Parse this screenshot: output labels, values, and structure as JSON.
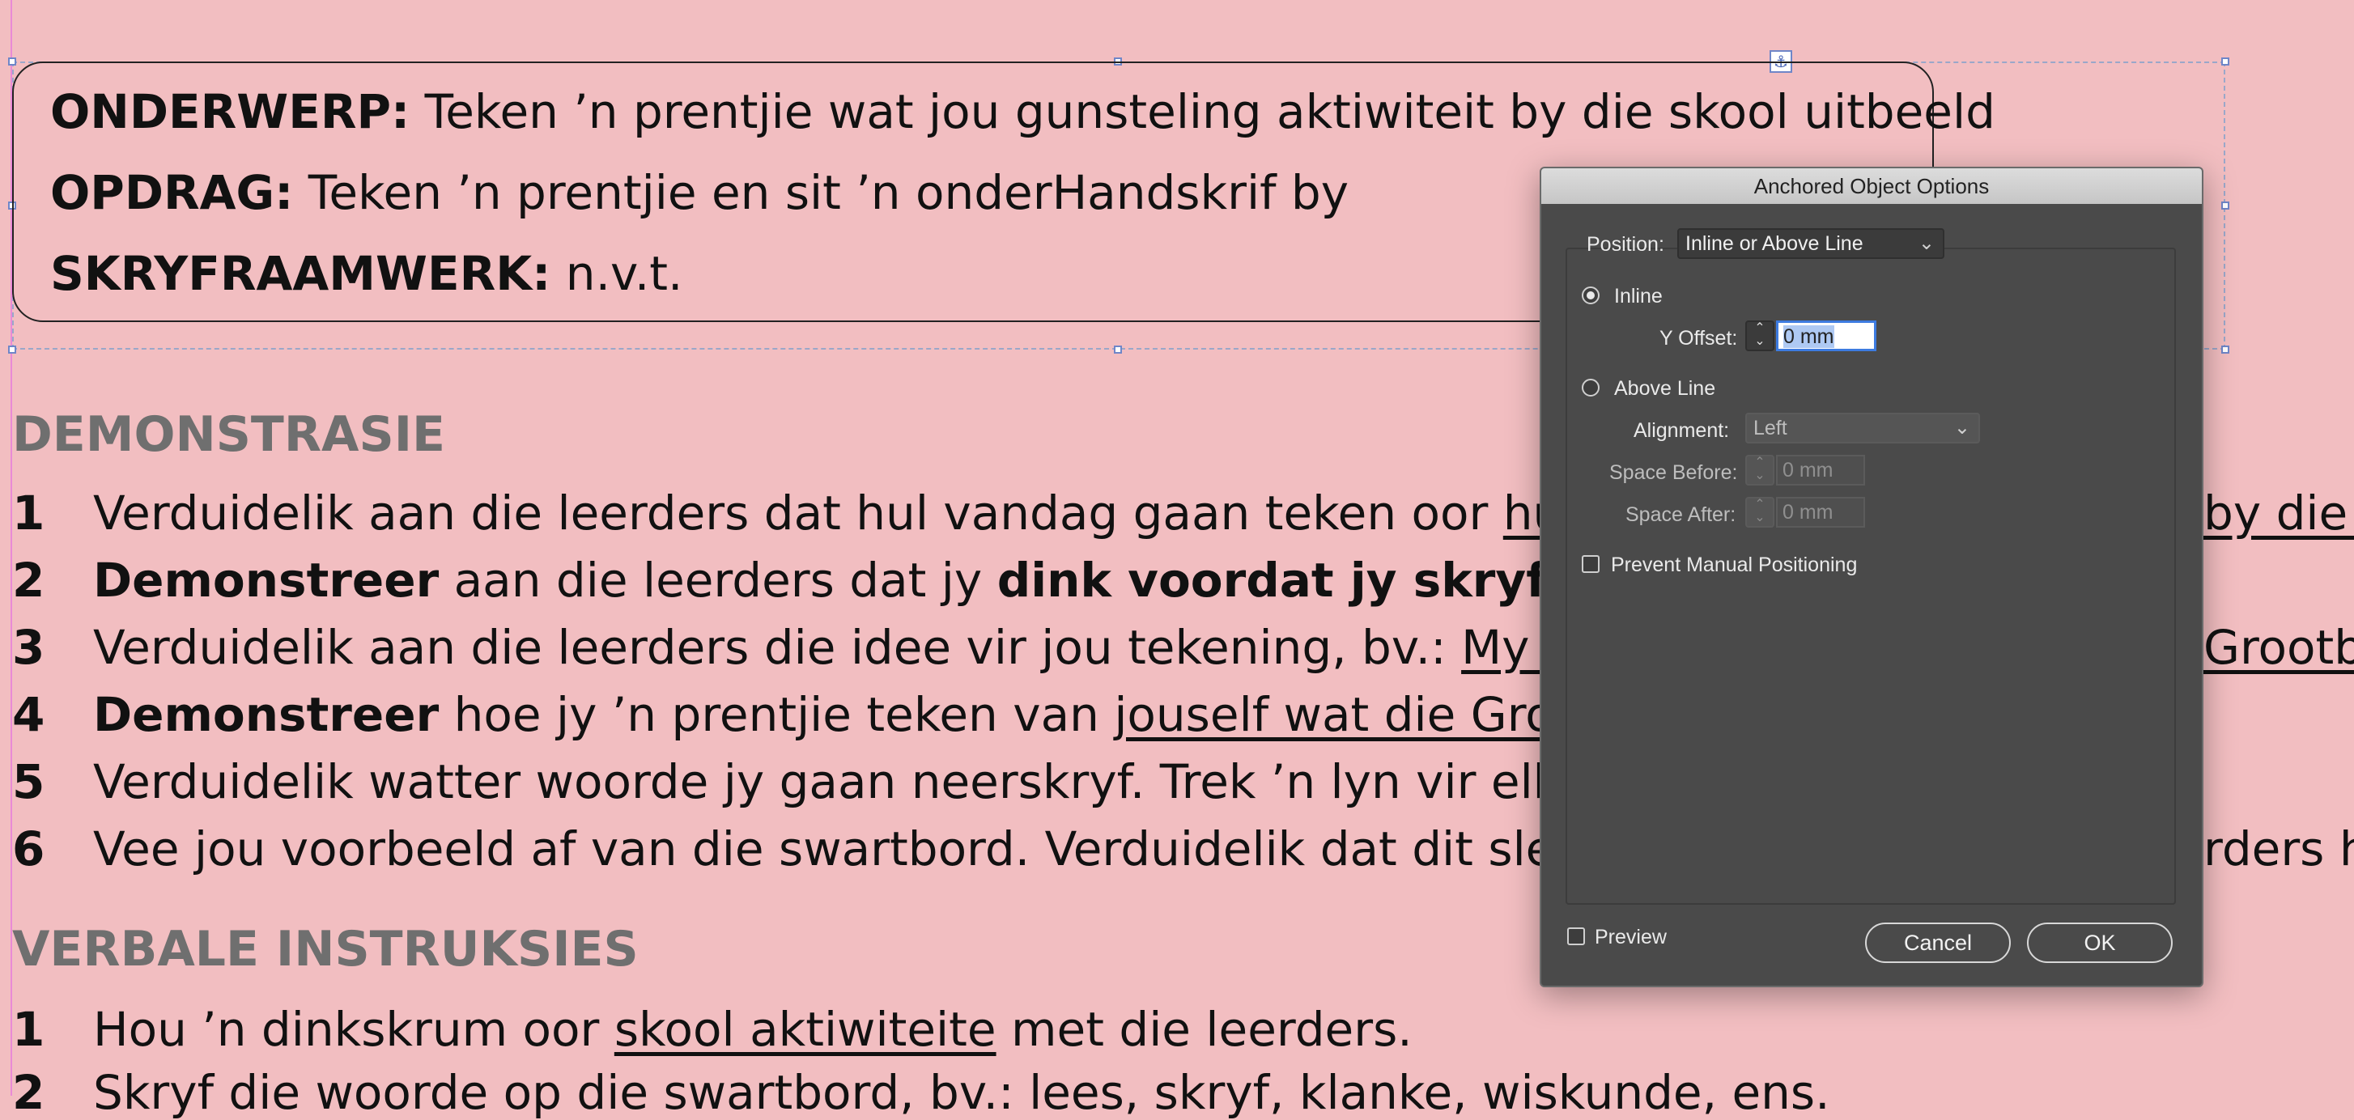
{
  "document": {
    "top_box": [
      {
        "label": "ONDERWERP:",
        "text": " Teken ’n prentjie wat jou gunsteling aktiwiteit by die skool uitbeeld"
      },
      {
        "label": "OPDRAG:",
        "text": " Teken ’n prentjie en sit ’n onderHandskrif by"
      },
      {
        "label": "SKRYFRAAMWERK:",
        "text": " n.v.t."
      }
    ],
    "section1_heading": "DEMONSTRASIE",
    "section1_items": [
      {
        "num": "1",
        "a": "Verduidelik aan die leerders dat hul vandag gaan teken oor ",
        "u": "hul",
        "rest": "",
        "tail_u": "by die s"
      },
      {
        "num": "2",
        "b1": "Demonstreer",
        "m": " aan die leerders dat jy ",
        "b2": "dink voordat jy skryf",
        "end": "."
      },
      {
        "num": "3",
        "a": "Verduidelik aan die leerders die idee vir jou tekening, bv.: ",
        "u": "My gu",
        "tail_u": "Grootbo"
      },
      {
        "num": "4",
        "b1": "Demonstreer",
        "m": " hoe jy ’n prentjie teken van ",
        "u": "jouself wat die Grootb"
      },
      {
        "num": "5",
        "a": "Verduidelik watter woorde jy gaan neerskryf. Trek ’n lyn vir elke"
      },
      {
        "num": "6",
        "a": "Vee jou voorbeeld af van die swartbord. Verduidelik dat dit sleg",
        "tail": "rders h"
      }
    ],
    "section2_heading": "VERBALE INSTRUKSIES",
    "section2_items": [
      {
        "num": "1",
        "a": "Hou ’n dinkskrum oor ",
        "u": "skool aktiwiteite",
        "rest": " met die leerders."
      },
      {
        "num": "2",
        "a": "Skryf die woorde op die swartbord, bv.: lees, skryf, klanke, wiskunde, ens."
      }
    ]
  },
  "dialog": {
    "title": "Anchored Object Options",
    "position_label": "Position:",
    "position_value": "Inline or Above Line",
    "inline_label": "Inline",
    "y_offset_label": "Y Offset:",
    "y_offset_value": "0 mm",
    "above_line_label": "Above Line",
    "alignment_label": "Alignment:",
    "alignment_value": "Left",
    "space_before_label": "Space Before:",
    "space_before_value": "0 mm",
    "space_after_label": "Space After:",
    "space_after_value": "0 mm",
    "prevent_label": "Prevent Manual Positioning",
    "preview_label": "Preview",
    "cancel_label": "Cancel",
    "ok_label": "OK"
  }
}
